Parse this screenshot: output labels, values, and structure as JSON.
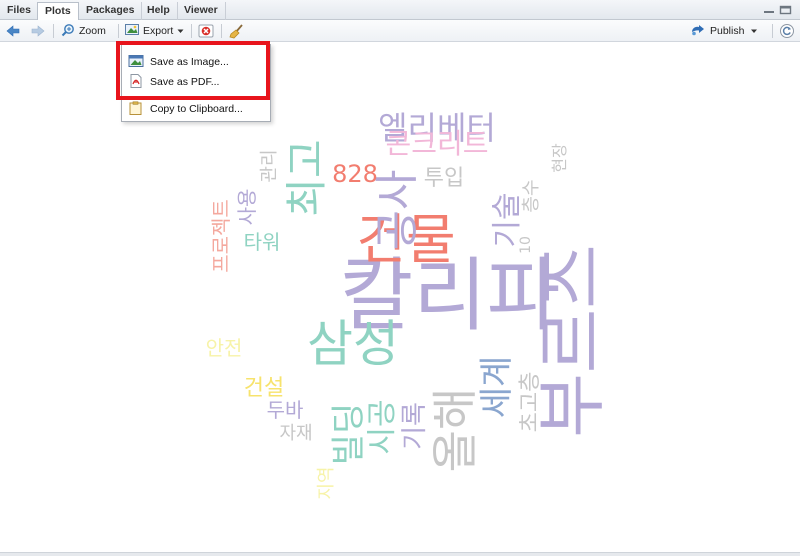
{
  "tabs": [
    "Files",
    "Plots",
    "Packages",
    "Help",
    "Viewer"
  ],
  "active_tab": "Plots",
  "toolbar": {
    "zoom_label": "Zoom",
    "export_label": "Export",
    "publish_label": "Publish"
  },
  "export_menu": {
    "items": [
      "Save as Image...",
      "Save as PDF...",
      "Copy to Clipboard..."
    ]
  },
  "colors": {
    "highlight": "#e8141c",
    "accent_blue": "#2f6db5"
  },
  "wordcloud": [
    {
      "text": "칼리파",
      "color": "#b3a9d6"
    },
    {
      "text": "부르즈",
      "color": "#b3a9d6"
    },
    {
      "text": "건물",
      "color": "#f27d6f"
    },
    {
      "text": "삼성",
      "color": "#8fd3c2"
    },
    {
      "text": "공사",
      "color": "#b3a9d6"
    },
    {
      "text": "최고",
      "color": "#8fd3c2"
    },
    {
      "text": "엘리베터",
      "color": "#b3a9d6"
    },
    {
      "text": "콘크리트",
      "color": "#f2b7d8"
    },
    {
      "text": "828",
      "color": "#f27d6f"
    },
    {
      "text": "투입",
      "color": "#c7c7c7"
    },
    {
      "text": "관리",
      "color": "#c7c7c7"
    },
    {
      "text": "프로젝트",
      "color": "#f4a89e"
    },
    {
      "text": "사용",
      "color": "#b3a9d6"
    },
    {
      "text": "타워",
      "color": "#8fd3c2"
    },
    {
      "text": "기술",
      "color": "#b3a9d6"
    },
    {
      "text": "10",
      "color": "#c7c7c7"
    },
    {
      "text": "층수",
      "color": "#c7c7c7"
    },
    {
      "text": "현장",
      "color": "#c7c7c7"
    },
    {
      "text": "세계",
      "color": "#8aa6cf"
    },
    {
      "text": "올해",
      "color": "#c7c7c7"
    },
    {
      "text": "초고층",
      "color": "#c7c7c7"
    },
    {
      "text": "빌딩",
      "color": "#8fd3c2"
    },
    {
      "text": "시공",
      "color": "#8fd3c2"
    },
    {
      "text": "기록",
      "color": "#b3a9d6"
    },
    {
      "text": "안전",
      "color": "#f7f3a8"
    },
    {
      "text": "건설",
      "color": "#f7e36d"
    },
    {
      "text": "두바",
      "color": "#b3a9d6"
    },
    {
      "text": "자재",
      "color": "#c7c7c7"
    },
    {
      "text": "지역",
      "color": "#f7f3a8"
    }
  ]
}
